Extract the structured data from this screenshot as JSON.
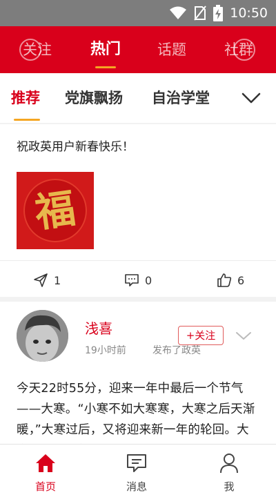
{
  "status_bar": {
    "time": "10:50"
  },
  "top_tabs": [
    {
      "label": "关注"
    },
    {
      "label": "热门"
    },
    {
      "label": "话题"
    },
    {
      "label": "社群"
    }
  ],
  "top_tabs_active": "热门",
  "category_tabs": [
    {
      "label": "推荐"
    },
    {
      "label": "党旗飘扬"
    },
    {
      "label": "自治学堂"
    }
  ],
  "category_active": "推荐",
  "post1": {
    "text": "祝政英用户新春快乐！",
    "image_glyph": "福",
    "share_count": "1",
    "comment_count": "0",
    "like_count": "6"
  },
  "post2": {
    "author": "浅喜",
    "time": "19小时前",
    "publish_info": "发布了政英",
    "follow_label": "+关注",
    "body": "今天22时55分，迎来一年中最后一个节气——大寒。“小寒不如大寒寒，大寒之后天渐暖，”大寒过后，又将迎来新一年的轮回。大寒节气是一年中"
  },
  "bottom_nav": [
    {
      "label": "首页",
      "icon": "home-icon"
    },
    {
      "label": "消息",
      "icon": "message-icon"
    },
    {
      "label": "我",
      "icon": "person-icon"
    }
  ],
  "colors": {
    "brand_red": "#d9001b",
    "accent_orange": "#f5a623",
    "status_bar_gray": "#7d7d7d"
  }
}
